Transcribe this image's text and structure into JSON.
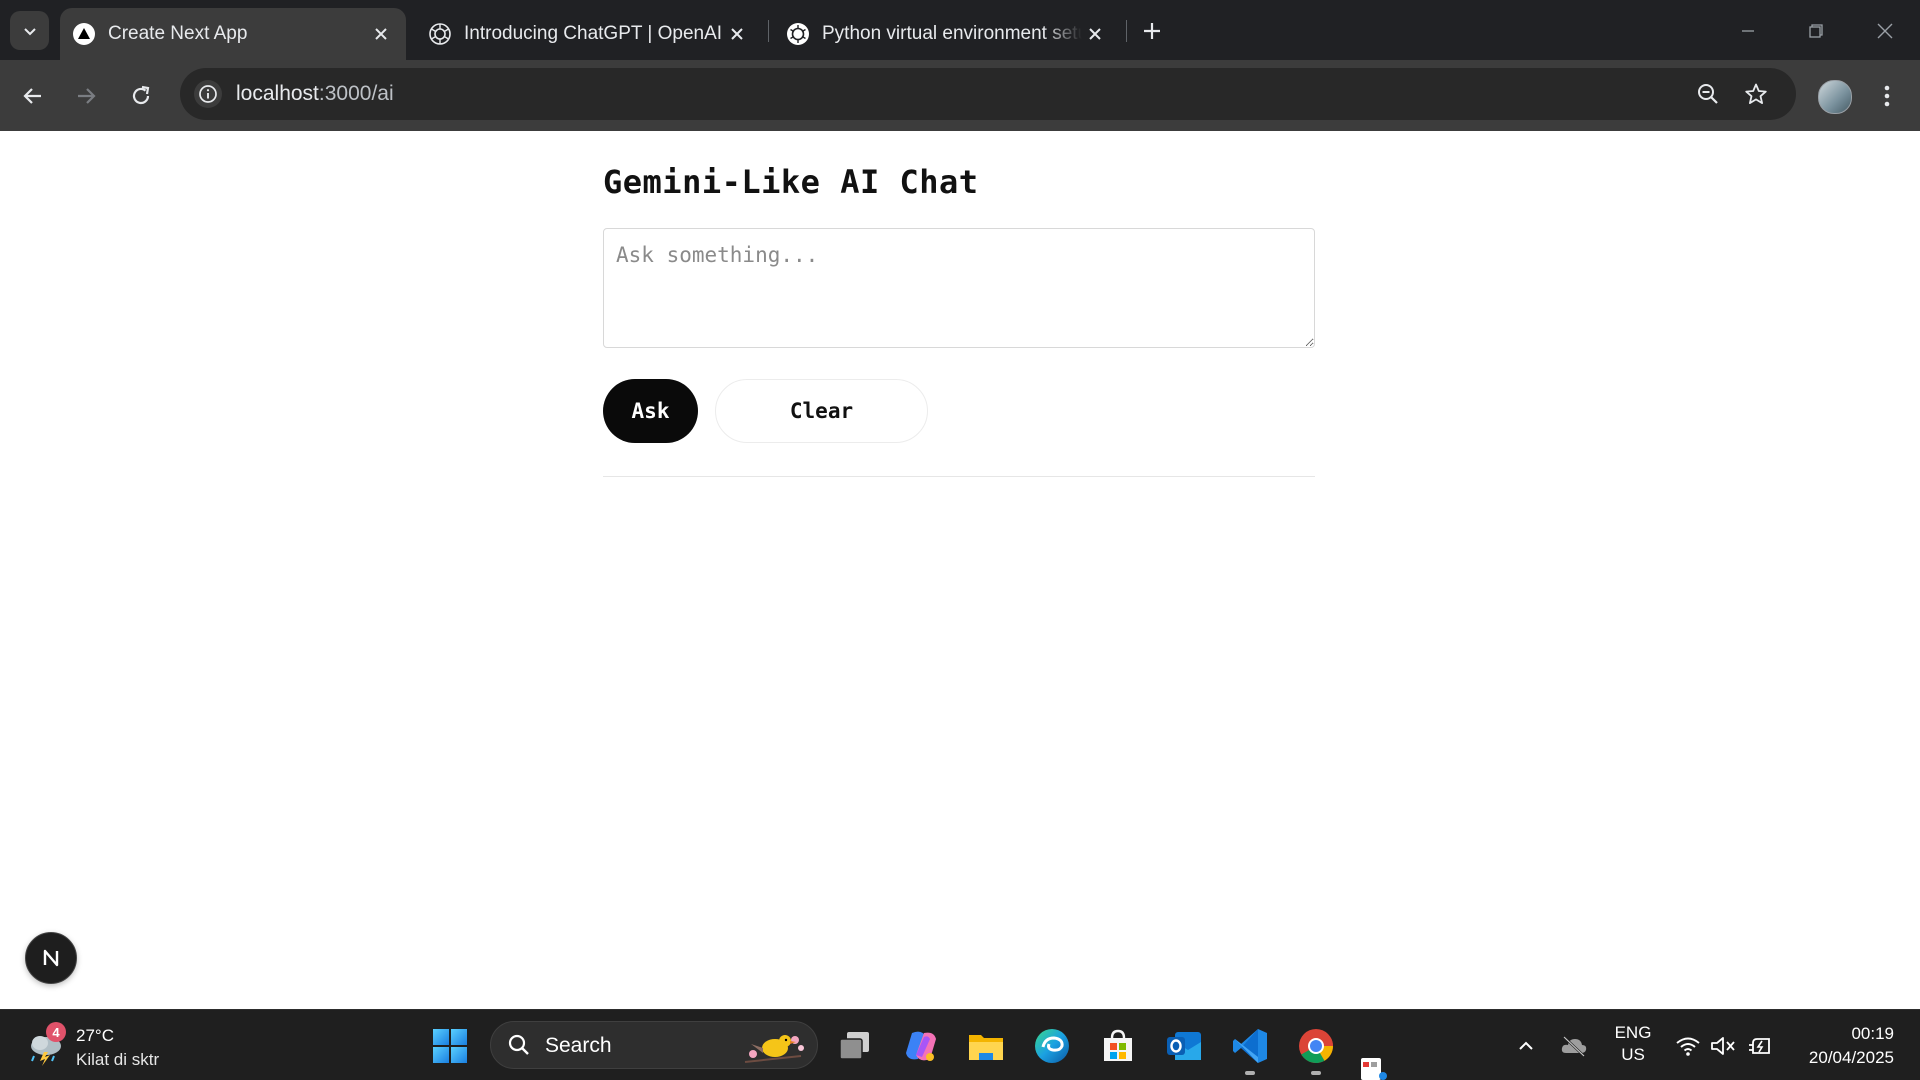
{
  "browser": {
    "tabs": [
      {
        "title": "Create Next App",
        "active": true,
        "favicon": "nextjs-triangle-icon"
      },
      {
        "title": "Introducing ChatGPT | OpenAI",
        "active": false,
        "favicon": "openai-icon"
      },
      {
        "title": "Python virtual environment setu",
        "active": false,
        "favicon": "chatgpt-icon"
      }
    ],
    "url_host": "localhost",
    "url_path": ":3000/ai"
  },
  "page": {
    "title": "Gemini-Like AI Chat",
    "prompt_placeholder": "Ask something...",
    "prompt_value": "",
    "ask_label": "Ask",
    "clear_label": "Clear",
    "dev_badge_label": "N"
  },
  "taskbar": {
    "weather_badge": "4",
    "weather_temp": "27°C",
    "weather_desc": "Kilat di sktr",
    "search_label": "Search",
    "apps": [
      "task-view",
      "copilot",
      "file-explorer",
      "edge",
      "microsoft-store",
      "outlook",
      "vscode",
      "chrome"
    ],
    "lang_line1": "ENG",
    "lang_line2": "US",
    "time": "00:19",
    "date": "20/04/2025"
  },
  "colors": {
    "accent_button": "#0a0a0a",
    "browser_frame": "#202124",
    "toolbar": "#3c3c3c",
    "taskbar": "#1f1f1f"
  }
}
